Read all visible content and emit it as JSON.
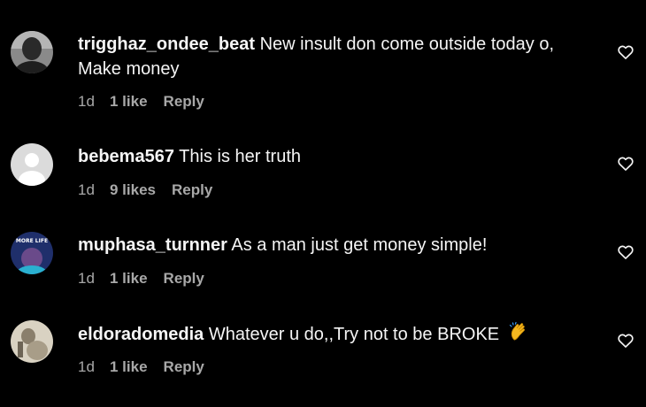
{
  "comments": [
    {
      "username": "trigghaz_ondee_beat",
      "text": "New insult don come outside today o, Make money",
      "time": "1d",
      "likes": "1 like",
      "reply": "Reply",
      "avatar": "person-photo-avatar"
    },
    {
      "username": "bebema567",
      "text": "This is her truth",
      "time": "1d",
      "likes": "9 likes",
      "reply": "Reply",
      "avatar": "default-gray-avatar"
    },
    {
      "username": "muphasa_turnner",
      "text": "As a man just get money simple!",
      "time": "1d",
      "likes": "1 like",
      "reply": "Reply",
      "avatar": "album-cover-avatar",
      "avatar_text": "MORE LIFE"
    },
    {
      "username": "eldoradomedia",
      "text": "Whatever u do,,Try not to be BROKE",
      "emoji": "clapping-hands-emoji",
      "time": "1d",
      "likes": "1 like",
      "reply": "Reply",
      "avatar": "sepia-photo-avatar"
    }
  ],
  "icons": {
    "like": "heart-outline-icon"
  },
  "colors": {
    "background": "#000000",
    "text": "#f5f5f5",
    "secondary": "#a8a8a8"
  }
}
